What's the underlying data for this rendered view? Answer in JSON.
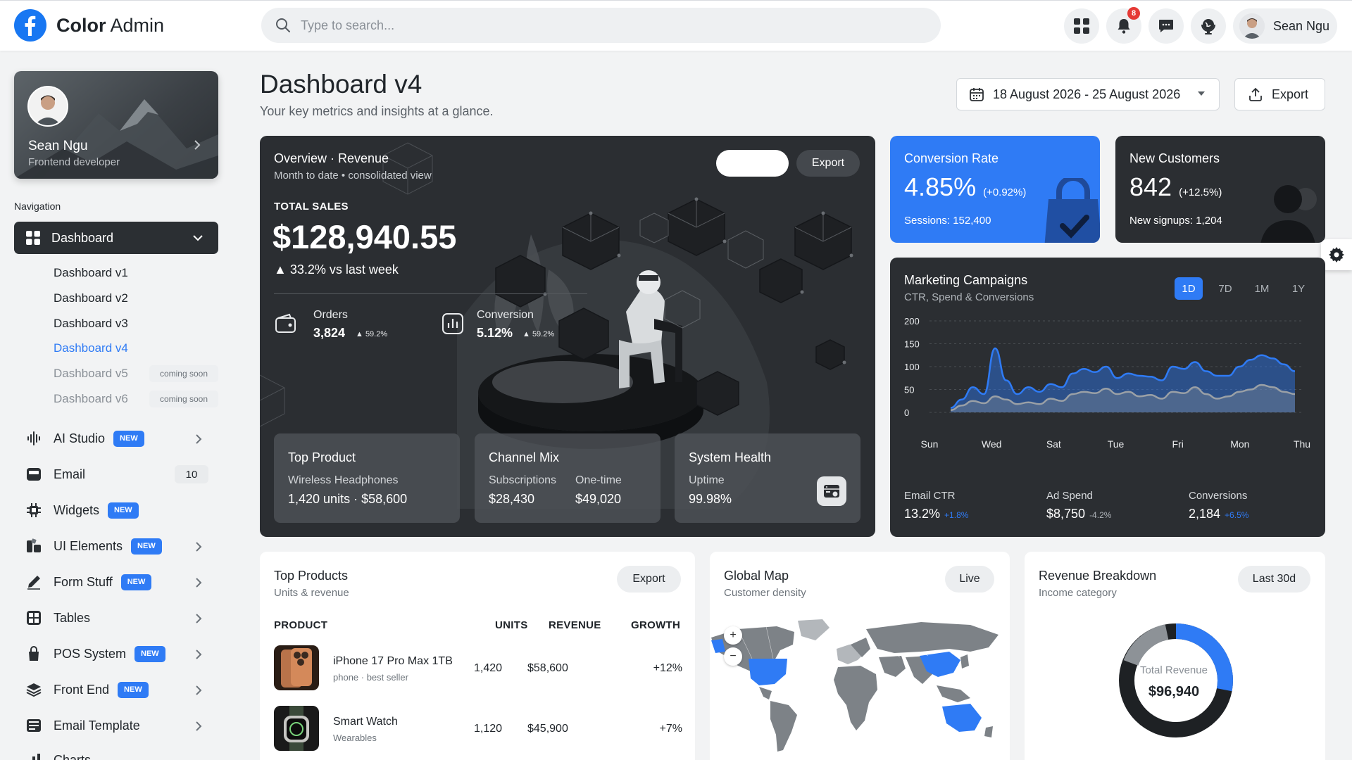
{
  "brand": {
    "name_bold": "Color",
    "name_rest": " Admin"
  },
  "search": {
    "placeholder": "Type to search..."
  },
  "header": {
    "notifications_count": "8",
    "user_name": "Sean Ngu"
  },
  "profile": {
    "name": "Sean Ngu",
    "role": "Frontend developer"
  },
  "nav": {
    "label": "Navigation",
    "active": "Dashboard",
    "sub_items": [
      {
        "label": "Dashboard v1"
      },
      {
        "label": "Dashboard v2"
      },
      {
        "label": "Dashboard v3"
      },
      {
        "label": "Dashboard v4"
      },
      {
        "label": "Dashboard v5",
        "badge": "coming soon"
      },
      {
        "label": "Dashboard v6",
        "badge": "coming soon"
      }
    ],
    "items": [
      {
        "label": "AI Studio",
        "badge": "NEW"
      },
      {
        "label": "Email",
        "count": "10"
      },
      {
        "label": "Widgets",
        "badge": "NEW"
      },
      {
        "label": "UI Elements",
        "badge": "NEW"
      },
      {
        "label": "Form Stuff",
        "badge": "NEW"
      },
      {
        "label": "Tables"
      },
      {
        "label": "POS System",
        "badge": "NEW"
      },
      {
        "label": "Front End",
        "badge": "NEW"
      },
      {
        "label": "Email Template"
      },
      {
        "label": "Charts"
      }
    ]
  },
  "page": {
    "title": "Dashboard v4",
    "subtitle": "Your key metrics and insights at a glance.",
    "date_range": "18 August 2026 - 25 August 2026",
    "export_label": "Export"
  },
  "revenue": {
    "title": "Overview · Revenue",
    "subtitle": "Month to date • consolidated view",
    "export_label": "Export",
    "total_label": "TOTAL SALES",
    "total_value": "$128,940.55",
    "total_delta": "▲ 33.2% vs last week",
    "orders_label": "Orders",
    "orders_value": "3,824",
    "orders_delta": "▲ 59.2%",
    "conversion_label": "Conversion",
    "conversion_value": "5.12%",
    "conversion_delta": "▲ 59.2%",
    "top_product_title": "Top Product",
    "top_product_name": "Wireless Headphones",
    "top_product_value": "1,420 units · $58,600",
    "channel_title": "Channel Mix",
    "channel_a_label": "Subscriptions",
    "channel_a_value": "$28,430",
    "channel_b_label": "One-time",
    "channel_b_value": "$49,020",
    "health_title": "System Health",
    "health_label": "Uptime",
    "health_value": "99.98%"
  },
  "conversion": {
    "title": "Conversion Rate",
    "value": "4.85%",
    "delta": "(+0.92%)",
    "foot": "Sessions: 152,400"
  },
  "customers": {
    "title": "New Customers",
    "value": "842",
    "delta": "(+12.5%)",
    "foot": "New signups: 1,204"
  },
  "marketing": {
    "title": "Marketing Campaigns",
    "subtitle": "CTR, Spend & Conversions",
    "ranges": [
      "1D",
      "7D",
      "1M",
      "1Y"
    ],
    "active_range": "1D",
    "stats": [
      {
        "label": "Email CTR",
        "value": "13.2%",
        "delta": "+1.8%",
        "color": "#2f7bf5"
      },
      {
        "label": "Ad Spend",
        "value": "$8,750",
        "delta": "-4.2%",
        "color": "#aeb3b8"
      },
      {
        "label": "Conversions",
        "value": "2,184",
        "delta": "+6.5%",
        "color": "#2f7bf5"
      }
    ]
  },
  "chart_data": {
    "type": "area",
    "categories": [
      "Sun",
      "Wed",
      "Sat",
      "Tue",
      "Fri",
      "Mon",
      "Thu"
    ],
    "yticks": [
      0,
      50,
      100,
      150,
      200
    ],
    "ylim": [
      0,
      200
    ],
    "grid": true,
    "legend": "none",
    "series": [
      {
        "values": [
          10,
          28,
          55,
          40,
          140,
          70,
          40,
          55,
          45,
          62,
          55,
          85,
          95,
          88,
          100,
          75,
          85,
          80,
          78,
          70,
          100,
          95,
          110,
          90,
          80,
          80,
          100,
          115,
          125,
          118,
          105,
          90
        ],
        "color": "#2f7bf5"
      },
      {
        "values": [
          5,
          15,
          25,
          20,
          35,
          28,
          18,
          22,
          18,
          30,
          25,
          40,
          45,
          42,
          52,
          40,
          45,
          35,
          38,
          30,
          45,
          42,
          55,
          40,
          30,
          35,
          45,
          50,
          60,
          55,
          45,
          40
        ],
        "color": "#9aa0a6"
      }
    ]
  },
  "top_products": {
    "title": "Top Products",
    "subtitle": "Units & revenue",
    "export_label": "Export",
    "headers": {
      "product": "PRODUCT",
      "units": "UNITS",
      "revenue": "REVENUE",
      "growth": "GROWTH"
    },
    "rows": [
      {
        "name": "iPhone 17 Pro Max 1TB",
        "category": "phone · best seller",
        "units": "1,420",
        "revenue": "$58,600",
        "growth": "+12%"
      },
      {
        "name": "Smart Watch",
        "category": "Wearables",
        "units": "1,120",
        "revenue": "$45,900",
        "growth": "+7%"
      }
    ]
  },
  "global_map": {
    "title": "Global Map",
    "subtitle": "Customer density",
    "live_label": "Live",
    "zoom_in": "+",
    "zoom_out": "−"
  },
  "revenue_breakdown": {
    "title": "Revenue Breakdown",
    "subtitle": "Income category",
    "range_label": "Last 30d",
    "center_label": "Total Revenue",
    "center_value": "$96,940",
    "blue_fraction": 0.28
  }
}
